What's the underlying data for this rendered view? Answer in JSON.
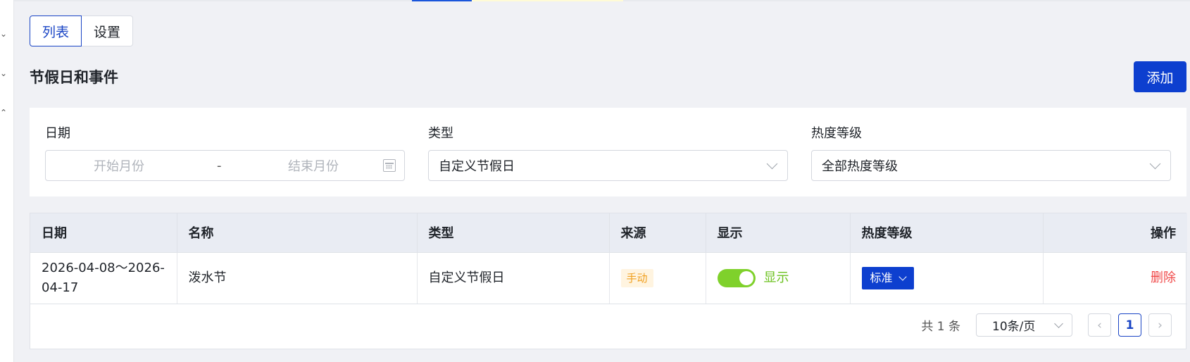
{
  "tabs": [
    {
      "label": "列表"
    },
    {
      "label": "设置"
    }
  ],
  "page": {
    "title": "节假日和事件",
    "add_label": "添加"
  },
  "filters": {
    "date": {
      "label": "日期",
      "start_placeholder": "开始月份",
      "separator": "-",
      "end_placeholder": "结束月份"
    },
    "type": {
      "label": "类型",
      "value": "自定义节假日"
    },
    "heat": {
      "label": "热度等级",
      "value": "全部热度等级"
    }
  },
  "table": {
    "headers": [
      "日期",
      "名称",
      "类型",
      "来源",
      "显示",
      "热度等级",
      "操作"
    ],
    "rows": [
      {
        "date": "2026-04-08～2026-04-17",
        "name": "泼水节",
        "type": "自定义节假日",
        "source": "手动",
        "display": "显示",
        "display_on": true,
        "level": "标准",
        "action": "删除"
      }
    ]
  },
  "pagination": {
    "total": "共 1 条",
    "page_size": "10条/页",
    "current": "1",
    "prev": "‹",
    "next": "›"
  },
  "colors": {
    "primary": "#0d3fcf",
    "switch_on": "#7fd12b",
    "danger": "#f04848",
    "tag_bg": "#fff4e0"
  }
}
